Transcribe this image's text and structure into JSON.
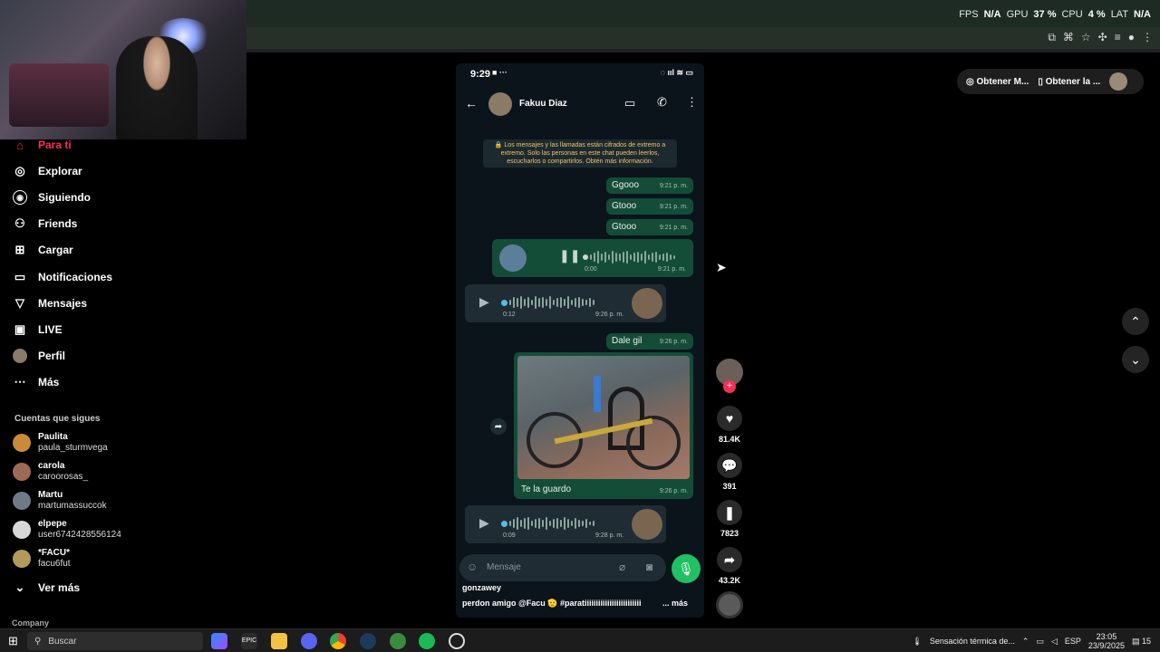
{
  "perf": {
    "fps_label": "FPS",
    "fps_value": "N/A",
    "gpu_label": "GPU",
    "gpu_value": "37 %",
    "cpu_label": "CPU",
    "cpu_value": "4 %",
    "lat_label": "LAT",
    "lat_value": "N/A"
  },
  "top_actions": {
    "get_model": "Obtener M...",
    "get_app": "Obtener la ..."
  },
  "sidebar": {
    "items": [
      {
        "label": "Para ti",
        "icon": "home-icon"
      },
      {
        "label": "Explorar",
        "icon": "compass-icon"
      },
      {
        "label": "Siguiendo",
        "icon": "following-icon"
      },
      {
        "label": "Friends",
        "icon": "friends-icon"
      },
      {
        "label": "Cargar",
        "icon": "upload-icon"
      },
      {
        "label": "Notificaciones",
        "icon": "bell-icon"
      },
      {
        "label": "Mensajes",
        "icon": "send-icon"
      },
      {
        "label": "LIVE",
        "icon": "live-icon"
      },
      {
        "label": "Perfil",
        "icon": "profile-icon"
      },
      {
        "label": "Más",
        "icon": "more-icon"
      }
    ],
    "following_title": "Cuentas que sigues",
    "following": [
      {
        "name": "Paulita",
        "user": "paula_sturmvega",
        "color": "#c98a3a"
      },
      {
        "name": "carola",
        "user": "caroorosas_",
        "color": "#9b6b58"
      },
      {
        "name": "Martu",
        "user": "martumassuccok",
        "color": "#6f7a86"
      },
      {
        "name": "elpepe",
        "user": "user6742428556124",
        "color": "#d8d8d8"
      },
      {
        "name": "*FACU*",
        "user": "facu6fut",
        "color": "#b49a5a"
      }
    ],
    "see_more": "Ver más",
    "company": "Company"
  },
  "phone": {
    "time": "9:29",
    "contact": "Fakuu Diaz",
    "encryption_note": "🔒 Los mensajes y las llamadas están cifrados de extremo a extremo. Solo las personas en este chat pueden leerlos, escucharlos o compartirlos. Obtén más información.",
    "messages": [
      {
        "text": "Ggooo",
        "time": "9:21 p. m."
      },
      {
        "text": "Gtooo",
        "time": "9:21 p. m."
      },
      {
        "text": "Gtooo",
        "time": "9:21 p. m."
      }
    ],
    "voice_out": {
      "duration": "0:00",
      "time": "9:21 p. m."
    },
    "voice_in1": {
      "duration": "0:12",
      "time": "9:26 p. m."
    },
    "dale": {
      "text": "Dale gil",
      "time": "9:26 p. m."
    },
    "photo_caption": {
      "text": "Te la guardo",
      "time": "9:26 p. m."
    },
    "voice_in2": {
      "duration": "0:09",
      "time": "9:28 p. m."
    },
    "input_placeholder": "Mensaje"
  },
  "video": {
    "author": "gonzawey",
    "caption": "perdon amigo @Facu 🫡 #paratiiiiiiiiiiiiiiiiiiiiiiiii",
    "more": "... más"
  },
  "actions": {
    "likes": "81.4K",
    "comments": "391",
    "saves": "7823",
    "shares": "43.2K"
  },
  "taskbar": {
    "search": "Buscar",
    "weather": "Sensación térmica de...",
    "lang": "ESP",
    "time": "23:05",
    "date": "23/9/2025",
    "notif": "15"
  }
}
